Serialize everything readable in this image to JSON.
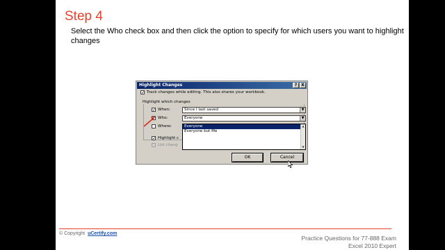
{
  "slide": {
    "step_title": "Step 4",
    "instruction": "Select the Who check box and then click the option to specify for which users you want to highlight changes"
  },
  "dialog": {
    "title": "Highlight Changes",
    "help_label": "?",
    "close_label": "X",
    "track_changes": {
      "label": "Track changes while editing. This also shares your workbook.",
      "checked": true
    },
    "group_label": "Highlight which changes",
    "when": {
      "label": "When:",
      "value": "Since I last saved",
      "checked": true
    },
    "who": {
      "label": "Who:",
      "value": "Everyone",
      "checked": true
    },
    "where": {
      "label": "Where:",
      "checked": false
    },
    "who_options": [
      "Everyone",
      "Everyone but Me"
    ],
    "who_selected_index": 0,
    "highlight_on_screen": {
      "label": "Highlight c",
      "checked": true
    },
    "list_changes": {
      "label": "List chang",
      "checked": false
    },
    "ok_label": "OK",
    "cancel_label": "Cancel",
    "check_mark": "✓",
    "arrow_glyph": "▼"
  },
  "footer": {
    "copyright_label": "© Copyright",
    "copyright_link": "uCertify.com",
    "line1": "Practice Questions for 77-888 Exam",
    "line2": "Excel 2010 Expert"
  },
  "colors": {
    "title_red": "#e8402a",
    "dialog_face": "#d4d0c8",
    "titlebar_blue": "#0a246a",
    "link_blue": "#1a4fb0"
  }
}
